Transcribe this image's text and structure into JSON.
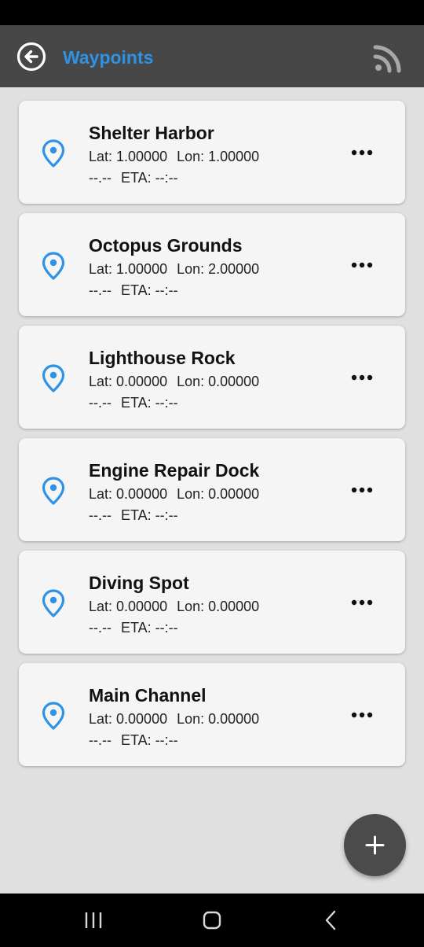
{
  "header": {
    "title": "Waypoints",
    "back_icon": "back-arrow-circle-icon",
    "action_icon": "rss-feed-icon"
  },
  "colors": {
    "accent": "#2e93e6",
    "app_bar": "#474747",
    "card_bg": "#f5f5f5",
    "background": "#e0e0e0",
    "fab": "#4b4b4b"
  },
  "waypoints": [
    {
      "name": "Shelter Harbor",
      "lat_label": "Lat: 1.00000",
      "lon_label": "Lon: 1.00000",
      "distance": "--.--",
      "eta_label": "ETA: --:--"
    },
    {
      "name": "Octopus Grounds",
      "lat_label": "Lat: 1.00000",
      "lon_label": "Lon: 2.00000",
      "distance": "--.--",
      "eta_label": "ETA: --:--"
    },
    {
      "name": "Lighthouse Rock",
      "lat_label": "Lat: 0.00000",
      "lon_label": "Lon: 0.00000",
      "distance": "--.--",
      "eta_label": "ETA: --:--"
    },
    {
      "name": "Engine Repair Dock",
      "lat_label": "Lat: 0.00000",
      "lon_label": "Lon: 0.00000",
      "distance": "--.--",
      "eta_label": "ETA: --:--"
    },
    {
      "name": "Diving Spot",
      "lat_label": "Lat: 0.00000",
      "lon_label": "Lon: 0.00000",
      "distance": "--.--",
      "eta_label": "ETA: --:--"
    },
    {
      "name": "Main Channel",
      "lat_label": "Lat: 0.00000",
      "lon_label": "Lon: 0.00000",
      "distance": "--.--",
      "eta_label": "ETA: --:--"
    }
  ],
  "fab": {
    "icon": "plus-icon"
  },
  "nav": {
    "icons": [
      "recent-apps-icon",
      "home-icon",
      "back-icon"
    ]
  }
}
